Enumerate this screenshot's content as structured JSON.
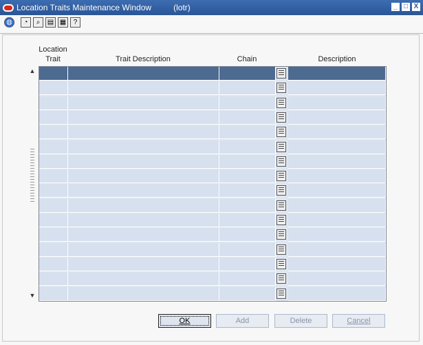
{
  "window": {
    "title": "Location Traits Maintenance Window",
    "code": "(lotr)",
    "controls": [
      "_",
      "□",
      "X"
    ]
  },
  "toolbar": {
    "buttons": [
      "globe-icon",
      "help-icon",
      "find-icon",
      "copy-icon",
      "print-icon",
      "question-icon"
    ]
  },
  "table": {
    "headers": {
      "location_trait_line1": "Location",
      "location_trait_line2": "Trait",
      "trait_description": "Trait Description",
      "chain": "Chain",
      "description": "Description"
    },
    "row_count": 16,
    "selected_row": 0
  },
  "buttons": {
    "ok": "OK",
    "add": "Add",
    "delete": "Delete",
    "cancel": "Cancel"
  }
}
